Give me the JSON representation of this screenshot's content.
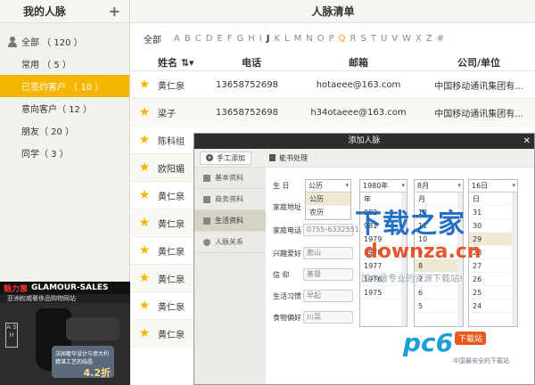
{
  "sidebar": {
    "title": "我的人脉",
    "add": "+",
    "groups": [
      {
        "label": "全部 （ 120 ）"
      },
      {
        "label": "常用 （ 5 ）"
      },
      {
        "label": "已签约客户 （ 10 ）"
      },
      {
        "label": "意向客户（ 12 ）"
      },
      {
        "label": "朋友（ 20 ）"
      },
      {
        "label": "同学（ 3 ）"
      }
    ],
    "ad": {
      "brand": "GLAMOUR-SALES",
      "hot": "魅力惠",
      "sub": "亚洲权威奢侈品购物网站",
      "logo": "A S H",
      "promo": "法国奢华设计与意大利精湛工艺的结晶",
      "discount": "4.2折"
    }
  },
  "main": {
    "title": "人脉清单",
    "all": "全部",
    "letters": [
      "A",
      "B",
      "C",
      "D",
      "E",
      "F",
      "G",
      "H",
      "I",
      "J",
      "K",
      "L",
      "M",
      "N",
      "O",
      "P",
      "Q",
      "R",
      "S",
      "T",
      "U",
      "V",
      "W",
      "X",
      "Z",
      "#"
    ],
    "headers": {
      "name": "姓名 ⇅▾",
      "phone": "电话",
      "email": "邮箱",
      "org": "公司/单位"
    },
    "rows": [
      {
        "name": "黄仁泉",
        "phone": "13658752698",
        "email": "hotaeee@163.com",
        "org": "中国移动通讯集团有..."
      },
      {
        "name": "梁子",
        "phone": "13658752698",
        "email": "h34otaeee@163.com",
        "org": "中国移动通讯集团有..."
      },
      {
        "name": "陈科组"
      },
      {
        "name": "欧阳媚"
      },
      {
        "name": "黄仁泉"
      },
      {
        "name": "黄仁泉"
      },
      {
        "name": "黄仁泉"
      },
      {
        "name": "黄仁泉"
      },
      {
        "name": "黄仁泉"
      },
      {
        "name": "黄仁泉"
      }
    ]
  },
  "dialog": {
    "title": "添加人脉",
    "close": "✕",
    "manual": "手工添加",
    "card": "能书处理",
    "nav": [
      "基本资料",
      "商务资料",
      "生活资料",
      "人脉关系"
    ],
    "fields": [
      {
        "label": "生 日"
      },
      {
        "label": "家庭地址"
      },
      {
        "label": "家庭电话",
        "value": "0755-6332551"
      },
      {
        "label": "兴趣爱好",
        "value": "爬山"
      },
      {
        "label": "信 仰",
        "value": "基督"
      },
      {
        "label": "生活习惯",
        "value": "早起"
      },
      {
        "label": "食物偏好",
        "value": "川菜"
      }
    ],
    "calendar": {
      "options": [
        "公历",
        "农历"
      ],
      "value": "公历"
    },
    "year": {
      "value": "1980年",
      "options": [
        "年",
        "982",
        "981",
        "1979",
        "1978",
        "1977",
        "1976",
        "1975"
      ]
    },
    "month": {
      "value": "8月",
      "options": [
        "月",
        "12",
        "11",
        "10",
        "9",
        "8",
        "7",
        "6",
        "5"
      ]
    },
    "day": {
      "value": "16日",
      "options": [
        "日",
        "31",
        "30",
        "29",
        "28",
        "27",
        "26",
        "25",
        "24"
      ]
    }
  },
  "watermark": {
    "cn": "下载之家",
    "en": "downza.cn",
    "slogan": "国内最专业的资源下载站!",
    "pc6": "pc6",
    "pc6_badge": "下载站",
    "pc6_sub": "中国最安全的下载站"
  }
}
